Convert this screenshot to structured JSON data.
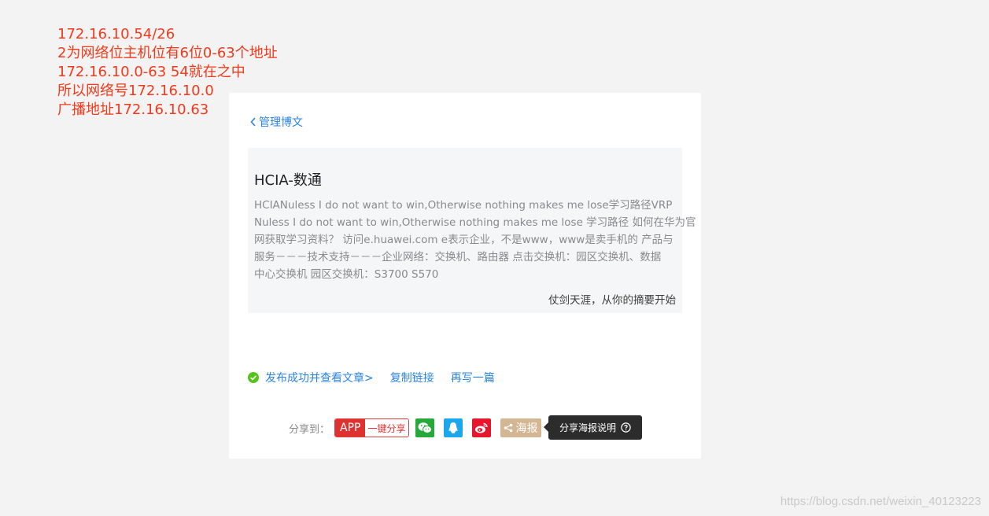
{
  "note": {
    "lines": [
      "172.16.10.54/26",
      "2为网络位主机位有6位0-63个地址",
      "172.16.10.0-63  54就在之中",
      "所以网络号172.16.10.0",
      "广播地址172.16.10.63"
    ],
    "color": "#f2391a"
  },
  "card": {
    "back_label": "管理博文",
    "summary": {
      "title": "HCIA-数通",
      "desc_lines": [
        "HCIANuless I do not want to win,Otherwise nothing makes me lose学习路径VRP",
        "Nuless I do not want to win,Otherwise nothing makes me lose 学习路径 如何在华为官",
        "网获取学习资料？ 访问e.huawei.com e表示企业，不是www，www是卖手机的 产品与",
        "服务－－－技术支持－－－企业网络：交换机、路由器 点击交换机：园区交换机、数据",
        "中心交换机 园区交换机：S3700 S570"
      ],
      "slogan": "仗剑天涯，从你的摘要开始"
    },
    "actions": {
      "published": "发布成功并查看文章>",
      "copy_link": "复制链接",
      "write_again": "再写一篇"
    },
    "share": {
      "label": "分享到：",
      "app": "APP",
      "one_click": "一键分享",
      "poster": "海报",
      "icons": [
        "wechat-icon",
        "qq-icon",
        "weibo-icon",
        "share-icon"
      ]
    },
    "tooltip": "分享海报说明"
  },
  "watermark": "https://blog.csdn.net/weixin_40123223",
  "colors": {
    "accent": "#2b84e0",
    "success": "#52c41a",
    "app_red": "#e03131",
    "wechat": "#25a93a",
    "qq": "#1ba7ee",
    "weibo": "#e6162d",
    "poster": "#d5b692"
  }
}
